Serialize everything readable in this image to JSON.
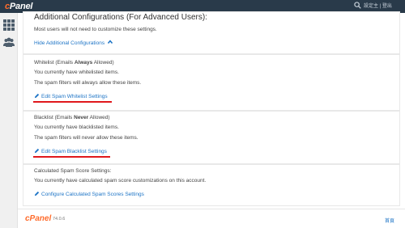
{
  "header": {
    "logo": "cPanel",
    "user_text": "設定主 | 登出",
    "search_icon": "search-icon"
  },
  "sidebar": {
    "items": [
      {
        "icon": "grid-icon"
      },
      {
        "icon": "users-icon"
      }
    ]
  },
  "additional": {
    "title": "Additional Configurations (For Advanced Users):",
    "subtitle": "Most users will not need to customize these settings.",
    "hide_link": "Hide Additional Configurations"
  },
  "whitelist": {
    "label_prefix": "Whitelist (Emails ",
    "label_bold": "Always",
    "label_suffix": " Allowed)",
    "line1": "You currently have whitelisted items.",
    "line2": "The spam filters will always allow these items.",
    "edit_link": "Edit Spam Whitelist Settings"
  },
  "blacklist": {
    "label_prefix": "Blacklist (Emails ",
    "label_bold": "Never",
    "label_suffix": " Allowed)",
    "line1": "You currently have blacklisted items.",
    "line2": "The spam filters will never allow these items.",
    "edit_link": "Edit Spam Blacklist Settings"
  },
  "score": {
    "label": "Calculated Spam Score Settings:",
    "line1": "You currently have calculated spam score customizations on this account.",
    "config_link": "Configure Calculated Spam Scores Settings"
  },
  "footer": {
    "logo": "cPanel",
    "version": "74.0.6",
    "home_link": "首頁"
  },
  "colors": {
    "header_bg": "#293a4a",
    "brand_orange": "#ff6c2c",
    "link_blue": "#1d74c6",
    "annotation_red": "#e0181c"
  }
}
